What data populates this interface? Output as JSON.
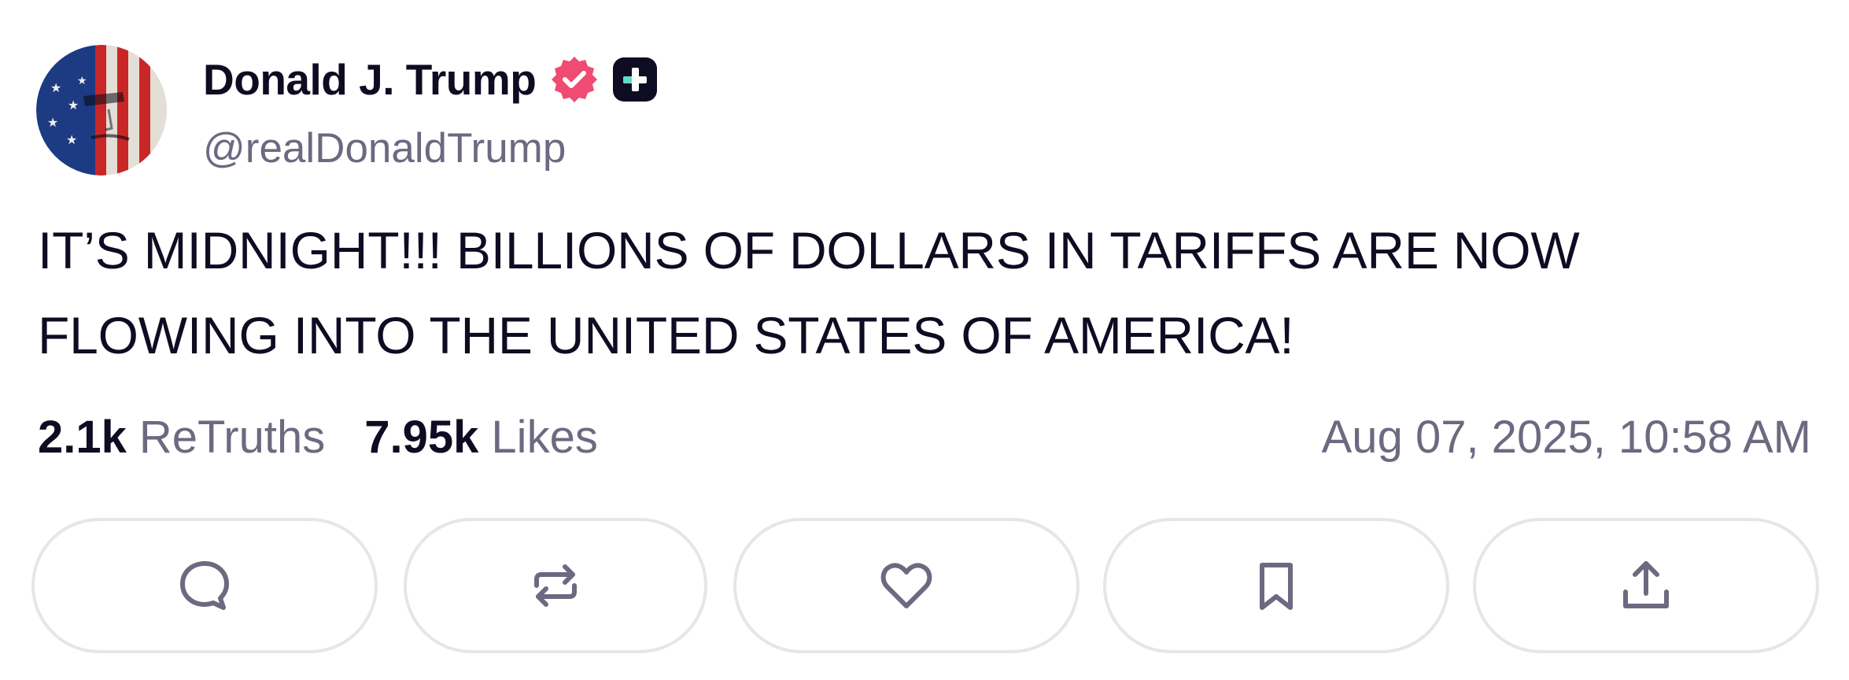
{
  "post": {
    "author": {
      "display_name": "Donald J. Trump",
      "handle": "@realDonaldTrump",
      "verified_color": "#ef4b73"
    },
    "text": "IT’S MIDNIGHT!!! BILLIONS OF DOLLARS IN TARIFFS ARE NOW FLOWING INTO THE UNITED STATES OF AMERICA!",
    "stats": {
      "retruths_count": "2.1k",
      "retruths_label": "ReTruths",
      "likes_count": "7.95k",
      "likes_label": "Likes"
    },
    "timestamp": "Aug 07, 2025, 10:58 AM"
  },
  "actions": [
    {
      "name": "reply",
      "icon": "speech-bubble-icon"
    },
    {
      "name": "retruth",
      "icon": "repost-arrows-icon"
    },
    {
      "name": "like",
      "icon": "heart-icon"
    },
    {
      "name": "bookmark",
      "icon": "bookmark-icon"
    },
    {
      "name": "share",
      "icon": "share-upload-icon"
    }
  ],
  "colors": {
    "text_primary": "#0d0c22",
    "text_secondary": "#6b6a80",
    "button_border": "#e6e6ea",
    "accent_badge": "#ef4b73",
    "plus_badge_bg": "#0d0c22",
    "plus_badge_teal": "#5fdcc7"
  }
}
